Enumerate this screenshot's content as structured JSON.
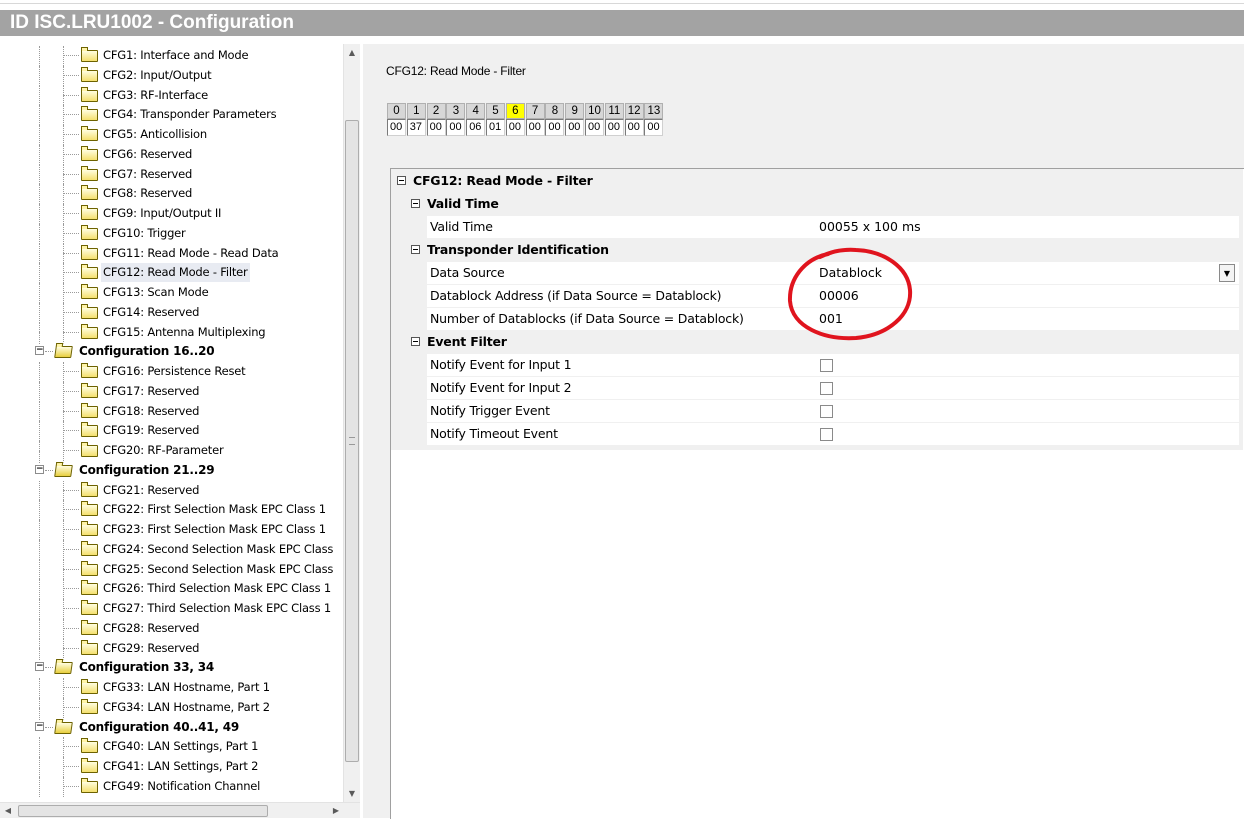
{
  "window": {
    "title": "ID ISC.LRU1002 - Configuration"
  },
  "tree": {
    "rows": [
      {
        "label": "CFG1: Interface and Mode",
        "type": "item"
      },
      {
        "label": "CFG2: Input/Output",
        "type": "item"
      },
      {
        "label": "CFG3: RF-Interface",
        "type": "item"
      },
      {
        "label": "CFG4: Transponder Parameters",
        "type": "item"
      },
      {
        "label": "CFG5: Anticollision",
        "type": "item"
      },
      {
        "label": "CFG6: Reserved",
        "type": "item"
      },
      {
        "label": "CFG7: Reserved",
        "type": "item"
      },
      {
        "label": "CFG8: Reserved",
        "type": "item"
      },
      {
        "label": "CFG9: Input/Output II",
        "type": "item"
      },
      {
        "label": "CFG10: Trigger",
        "type": "item"
      },
      {
        "label": "CFG11: Read Mode - Read Data",
        "type": "item"
      },
      {
        "label": "CFG12: Read Mode - Filter",
        "type": "item",
        "selected": true
      },
      {
        "label": "CFG13: Scan Mode",
        "type": "item"
      },
      {
        "label": "CFG14: Reserved",
        "type": "item"
      },
      {
        "label": "CFG15: Antenna Multiplexing",
        "type": "item"
      },
      {
        "label": "Configuration 16..20",
        "type": "group"
      },
      {
        "label": "CFG16: Persistence Reset",
        "type": "item"
      },
      {
        "label": "CFG17: Reserved",
        "type": "item"
      },
      {
        "label": "CFG18: Reserved",
        "type": "item"
      },
      {
        "label": "CFG19: Reserved",
        "type": "item"
      },
      {
        "label": "CFG20: RF-Parameter",
        "type": "item"
      },
      {
        "label": "Configuration 21..29",
        "type": "group"
      },
      {
        "label": "CFG21: Reserved",
        "type": "item"
      },
      {
        "label": "CFG22: First Selection Mask EPC Class 1",
        "type": "item"
      },
      {
        "label": "CFG23: First Selection Mask EPC Class 1",
        "type": "item"
      },
      {
        "label": "CFG24: Second Selection Mask EPC Class",
        "type": "item"
      },
      {
        "label": "CFG25: Second Selection Mask EPC Class",
        "type": "item"
      },
      {
        "label": "CFG26: Third Selection Mask EPC Class 1",
        "type": "item"
      },
      {
        "label": "CFG27: Third Selection Mask EPC Class 1",
        "type": "item"
      },
      {
        "label": "CFG28: Reserved",
        "type": "item"
      },
      {
        "label": "CFG29: Reserved",
        "type": "item"
      },
      {
        "label": "Configuration 33, 34",
        "type": "group"
      },
      {
        "label": "CFG33: LAN Hostname, Part 1",
        "type": "item"
      },
      {
        "label": "CFG34: LAN Hostname, Part 2",
        "type": "item"
      },
      {
        "label": "Configuration 40..41, 49",
        "type": "group"
      },
      {
        "label": "CFG40: LAN Settings, Part 1",
        "type": "item"
      },
      {
        "label": "CFG41: LAN Settings, Part 2",
        "type": "item"
      },
      {
        "label": "CFG49: Notification Channel",
        "type": "item"
      }
    ]
  },
  "panel": {
    "heading": "CFG12: Read Mode - Filter",
    "byte_headers": [
      "0",
      "1",
      "2",
      "3",
      "4",
      "5",
      "6",
      "7",
      "8",
      "9",
      "10",
      "11",
      "12",
      "13"
    ],
    "byte_values": [
      "00",
      "37",
      "00",
      "00",
      "06",
      "01",
      "00",
      "00",
      "00",
      "00",
      "00",
      "00",
      "00",
      "00"
    ],
    "highlighted_byte": 6,
    "grid": {
      "root": "CFG12: Read Mode - Filter",
      "valid_time_cat": "Valid Time",
      "valid_time_name": "Valid Time",
      "valid_time_value": "00055 x 100 ms",
      "transponder_cat": "Transponder Identification",
      "data_source_name": "Data Source",
      "data_source_value": "Datablock",
      "db_address_name": "Datablock Address (if Data Source = Datablock)",
      "db_address_value": "00006",
      "db_count_name": "Number of Datablocks (if Data Source = Datablock)",
      "db_count_value": "001",
      "event_cat": "Event Filter",
      "notify_input1": "Notify Event for Input 1",
      "notify_input2": "Notify Event for Input 2",
      "notify_trigger": "Notify Trigger Event",
      "notify_timeout": "Notify Timeout Event",
      "checks": [
        false,
        false,
        false,
        false
      ]
    }
  },
  "colors": {
    "title_bar": "#a3a3a3",
    "highlight_byte": "#ffff00",
    "annotation": "#e0141e"
  }
}
